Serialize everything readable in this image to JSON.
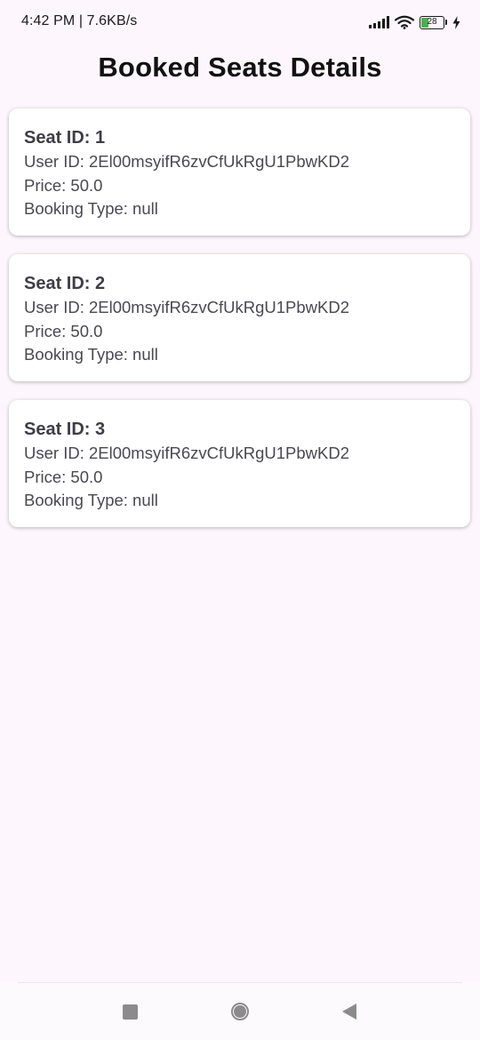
{
  "status_bar": {
    "time_speed": "4:42 PM | 7.6KB/s",
    "battery_level": "28",
    "icons": [
      "signal-icon",
      "wifi-icon",
      "battery-icon",
      "charging-bolt-icon"
    ]
  },
  "page": {
    "title": "Booked Seats Details"
  },
  "bookings": [
    {
      "seat_label": "Seat ID: 1",
      "user_label": "User ID: 2El00msyifR6zvCfUkRgU1PbwKD2",
      "price_label": "Price: 50.0",
      "type_label": "Booking Type: null"
    },
    {
      "seat_label": "Seat ID: 2",
      "user_label": "User ID: 2El00msyifR6zvCfUkRgU1PbwKD2",
      "price_label": "Price: 50.0",
      "type_label": "Booking Type: null"
    },
    {
      "seat_label": "Seat ID: 3",
      "user_label": "User ID: 2El00msyifR6zvCfUkRgU1PbwKD2",
      "price_label": "Price: 50.0",
      "type_label": "Booking Type: null"
    }
  ],
  "nav_bar": {
    "icons": [
      "recents-square-icon",
      "home-circle-icon",
      "back-triangle-icon"
    ]
  },
  "colors": {
    "background": "#fdf7fd",
    "card": "#ffffff",
    "battery_fill": "#4caf50"
  }
}
